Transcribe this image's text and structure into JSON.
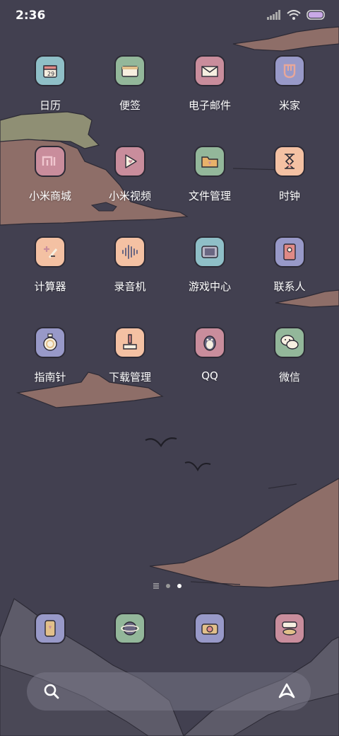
{
  "status_bar": {
    "time": "2:36",
    "signal_icon": "cellular-signal-icon",
    "wifi_icon": "wifi-icon",
    "battery_icon": "battery-icon"
  },
  "apps": [
    {
      "label": "日历",
      "icon": "calendar-icon",
      "color": "#8fbfc7"
    },
    {
      "label": "便签",
      "icon": "notes-icon",
      "color": "#93b79a"
    },
    {
      "label": "电子邮件",
      "icon": "email-icon",
      "color": "#c98d9c"
    },
    {
      "label": "米家",
      "icon": "mijia-icon",
      "color": "#9899c8"
    },
    {
      "label": "小米商城",
      "icon": "mi-store-icon",
      "color": "#c98d9c"
    },
    {
      "label": "小米视频",
      "icon": "video-icon",
      "color": "#c98d9c"
    },
    {
      "label": "文件管理",
      "icon": "folder-icon",
      "color": "#93b79a"
    },
    {
      "label": "时钟",
      "icon": "hourglass-icon",
      "color": "#f4c1a3"
    },
    {
      "label": "计算器",
      "icon": "calculator-icon",
      "color": "#f4c1a3"
    },
    {
      "label": "录音机",
      "icon": "sound-wave-icon",
      "color": "#f4c1a3"
    },
    {
      "label": "游戏中心",
      "icon": "game-center-icon",
      "color": "#8fbfc7"
    },
    {
      "label": "联系人",
      "icon": "contacts-icon",
      "color": "#9899c8"
    },
    {
      "label": "指南针",
      "icon": "compass-icon",
      "color": "#9899c8"
    },
    {
      "label": "下载管理",
      "icon": "download-icon",
      "color": "#f4c1a3"
    },
    {
      "label": "QQ",
      "icon": "qq-penguin-icon",
      "color": "#c98d9c"
    },
    {
      "label": "微信",
      "icon": "wechat-icon",
      "color": "#93b79a"
    }
  ],
  "page_indicator": {
    "pages": 3,
    "current": 3
  },
  "dock": [
    {
      "icon": "phone-icon",
      "color": "#9899c8"
    },
    {
      "icon": "browser-icon",
      "color": "#93b79a"
    },
    {
      "icon": "camera-icon",
      "color": "#9899c8"
    },
    {
      "icon": "gallery-icon",
      "color": "#c98d9c"
    }
  ],
  "search_bar": {
    "search_icon": "search-icon",
    "assistant_icon": "assistant-icon"
  }
}
